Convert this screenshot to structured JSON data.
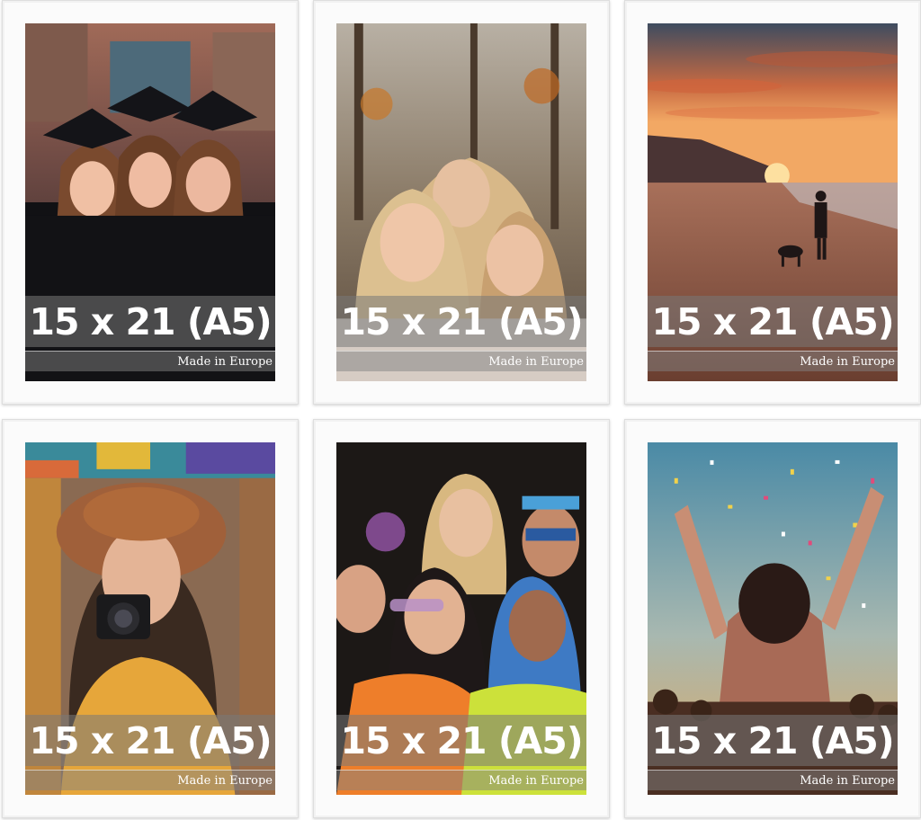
{
  "frames": [
    {
      "size_label": "15 x 21 (A5)",
      "made_label": "Made in Europe",
      "scene": "graduates"
    },
    {
      "size_label": "15 x 21 (A5)",
      "made_label": "Made in Europe",
      "scene": "kids-autumn"
    },
    {
      "size_label": "15 x 21 (A5)",
      "made_label": "Made in Europe",
      "scene": "beach-sunset"
    },
    {
      "size_label": "15 x 21 (A5)",
      "made_label": "Made in Europe",
      "scene": "photographer"
    },
    {
      "size_label": "15 x 21 (A5)",
      "made_label": "Made in Europe",
      "scene": "party-friends"
    },
    {
      "size_label": "15 x 21 (A5)",
      "made_label": "Made in Europe",
      "scene": "confetti-concert"
    }
  ],
  "colors": {
    "frame": "#fbfbfb",
    "band": "#787878",
    "text": "#ffffff"
  }
}
